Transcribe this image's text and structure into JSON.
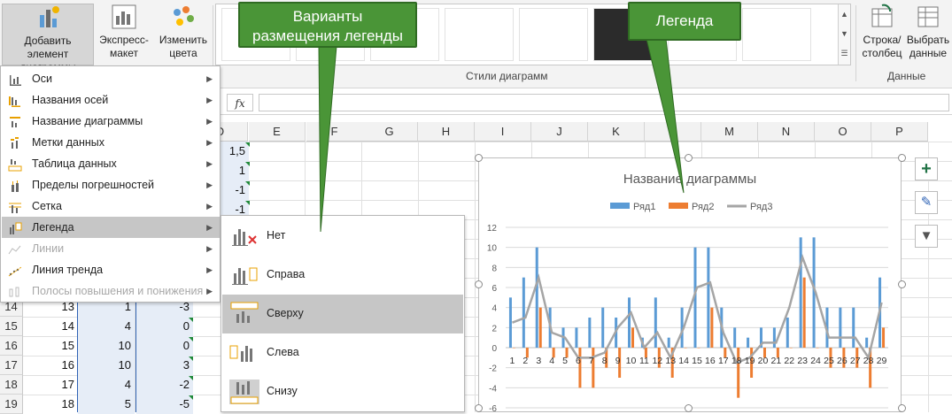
{
  "ribbon": {
    "add_element": "Добавить элемент\nдиаграммы",
    "quick_layout": "Экспресс-\nмакет",
    "change_colors": "Изменить\nцвета",
    "styles_group": "Стили диаграмм",
    "switch_row_col": "Строка/\nстолбец",
    "select_data": "Выбрать\nданные",
    "data_group": "Данные",
    "dropdown_arrow": "▾",
    "fx": "fx"
  },
  "columns": [
    "D",
    "E",
    "F",
    "G",
    "H",
    "I",
    "J",
    "K",
    "L",
    "M",
    "N",
    "O",
    "P"
  ],
  "sheet_d_values": [
    "1,5",
    "1",
    "-1",
    "-1"
  ],
  "rows": [
    {
      "num": "14",
      "a": "13",
      "b": "1",
      "c": "-3"
    },
    {
      "num": "15",
      "a": "14",
      "b": "4",
      "c": "0"
    },
    {
      "num": "16",
      "a": "15",
      "b": "10",
      "c": "0"
    },
    {
      "num": "17",
      "a": "16",
      "b": "10",
      "c": "3"
    },
    {
      "num": "18",
      "a": "17",
      "b": "4",
      "c": "-2"
    },
    {
      "num": "19",
      "a": "18",
      "b": "5",
      "c": "-5"
    }
  ],
  "menu": {
    "items": [
      {
        "label": "Оси",
        "icon": "axes-icon",
        "disabled": false
      },
      {
        "label": "Названия осей",
        "icon": "axis-titles-icon",
        "disabled": false
      },
      {
        "label": "Название диаграммы",
        "icon": "chart-title-icon",
        "disabled": false
      },
      {
        "label": "Метки данных",
        "icon": "data-labels-icon",
        "disabled": false
      },
      {
        "label": "Таблица данных",
        "icon": "data-table-icon",
        "disabled": false
      },
      {
        "label": "Пределы погрешностей",
        "icon": "error-bars-icon",
        "disabled": false
      },
      {
        "label": "Сетка",
        "icon": "gridlines-icon",
        "disabled": false
      },
      {
        "label": "Легенда",
        "icon": "legend-icon",
        "disabled": false
      },
      {
        "label": "Линии",
        "icon": "lines-icon",
        "disabled": true
      },
      {
        "label": "Линия тренда",
        "icon": "trendline-icon",
        "disabled": false
      },
      {
        "label": "Полосы повышения и понижения",
        "icon": "up-down-bars-icon",
        "disabled": true
      }
    ],
    "arrow": "▶"
  },
  "submenu": {
    "items": [
      {
        "label": "Нет",
        "icon": "legend-none-icon"
      },
      {
        "label": "Справа",
        "icon": "legend-right-icon"
      },
      {
        "label": "Сверху",
        "icon": "legend-top-icon"
      },
      {
        "label": "Слева",
        "icon": "legend-left-icon"
      },
      {
        "label": "Снизу",
        "icon": "legend-bottom-icon"
      }
    ]
  },
  "callouts": {
    "legend_options": "Варианты\nразмещения легенды",
    "legend": "Легенда"
  },
  "side_buttons": [
    "+",
    "✎",
    "▼"
  ],
  "colors": {
    "series1": "#5b9bd5",
    "series2": "#ed7d31",
    "series3": "#a5a5a5",
    "accent_green": "#4a9537",
    "excel_green": "#217346"
  },
  "chart_data": {
    "type": "bar",
    "title": "Название диаграммы",
    "categories": [
      "1",
      "2",
      "3",
      "4",
      "5",
      "6",
      "7",
      "8",
      "9",
      "10",
      "11",
      "12",
      "13",
      "14",
      "15",
      "16",
      "17",
      "18",
      "19",
      "20",
      "21",
      "22",
      "23",
      "24",
      "25",
      "26",
      "27",
      "28",
      "29"
    ],
    "series": [
      {
        "name": "Ряд1",
        "kind": "bar",
        "color": "#5b9bd5",
        "values": [
          5,
          7,
          10,
          4,
          2,
          2,
          3,
          4,
          3,
          5,
          1,
          5,
          1,
          4,
          10,
          10,
          4,
          2,
          1,
          2,
          2,
          3,
          11,
          11,
          4,
          4,
          4,
          1,
          7
        ]
      },
      {
        "name": "Ряд2",
        "kind": "bar",
        "color": "#ed7d31",
        "values": [
          0,
          -1,
          4,
          -1,
          -1,
          -4,
          -4,
          -2,
          -3,
          2,
          -1,
          -2,
          -3,
          0,
          0,
          4,
          -1,
          -5,
          -3,
          -1,
          -1,
          0,
          7,
          0,
          -2,
          -2,
          -2,
          -4,
          2
        ]
      },
      {
        "name": "Ряд3",
        "kind": "line",
        "color": "#a5a5a5",
        "values": [
          2.5,
          3,
          7,
          1.5,
          1,
          -1,
          -1,
          -0.5,
          2,
          3.5,
          0,
          1.5,
          -1,
          2,
          6,
          6.5,
          1.5,
          -1.5,
          -1,
          0.5,
          0.5,
          4,
          9,
          5.5,
          1,
          1,
          1,
          -1,
          4.5
        ]
      }
    ],
    "ylim": [
      -6,
      12
    ],
    "yticks": [
      -6,
      -4,
      -2,
      0,
      2,
      4,
      6,
      8,
      10,
      12
    ],
    "grid": true,
    "legend_position": "top"
  }
}
